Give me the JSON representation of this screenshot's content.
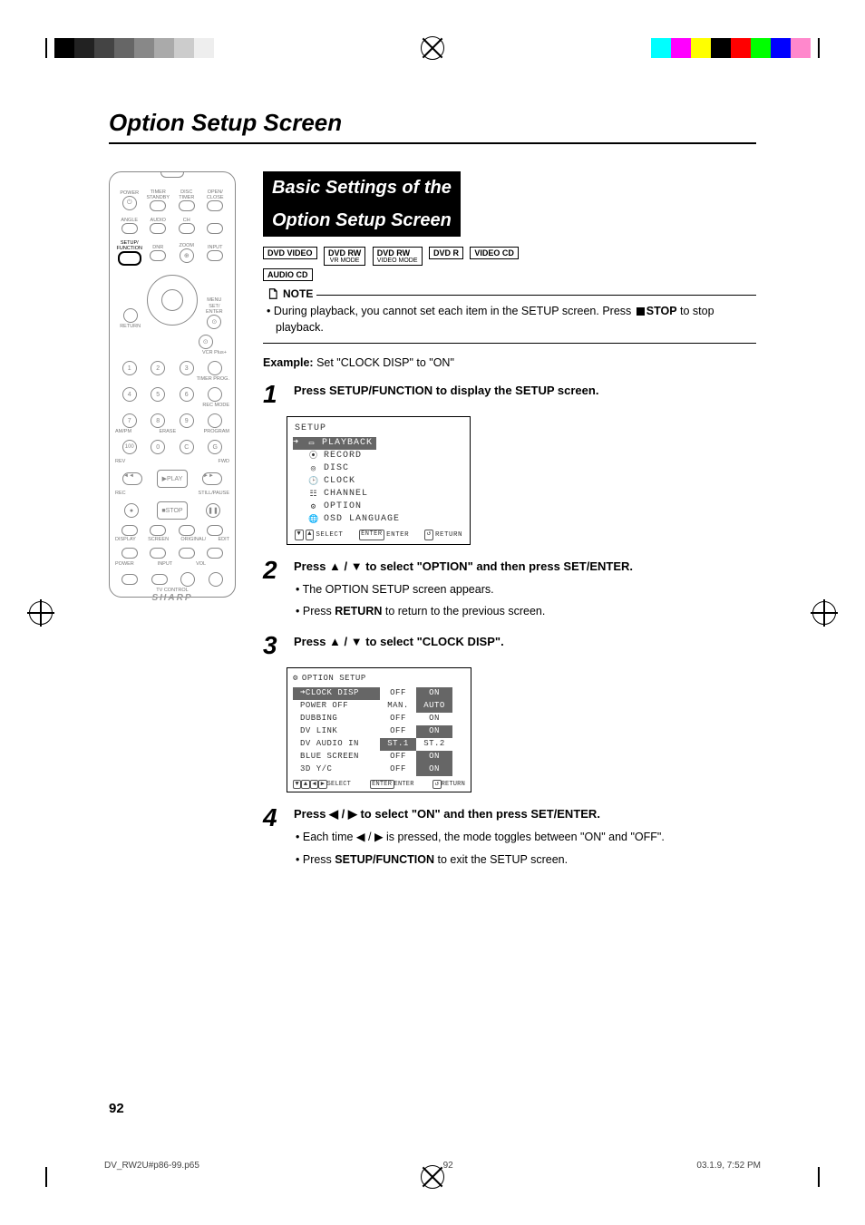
{
  "page_title": "Option Setup Screen",
  "page_number": "92",
  "remote": {
    "brand": "SHARP",
    "labels": {
      "power": "POWER",
      "timer_standby": "TIMER STANDBY",
      "disc_timer": "DISC TIMER",
      "open_close": "OPEN/ CLOSE",
      "angle": "ANGLE",
      "audio": "AUDIO",
      "ch": "CH",
      "setup_function": "SETUP/ FUNCTION",
      "dnr": "DNR",
      "zoom": "ZOOM",
      "input": "INPUT",
      "menu": "MENU",
      "return": "RETURN",
      "set_enter": "SET/ ENTER",
      "vcr_plus": "VCR Plus+",
      "timer_prog": "TIMER PROG.",
      "rec_mode": "REC MODE",
      "erase": "ERASE",
      "program": "PROGRAM",
      "am_pm": "AM/PM",
      "rev": "REV",
      "fwd": "FWD",
      "play": "PLAY",
      "rec": "REC",
      "stop": "STOP",
      "still_pause": "STILL/PAUSE",
      "display": "DISPLAY",
      "screen": "SCREEN",
      "original": "ORIGINAL/",
      "edit": "EDIT",
      "tv_power": "POWER",
      "tv_input": "INPUT",
      "vol": "VOL",
      "tv_control": "TV CONTROL",
      "c": "C",
      "g": "G"
    }
  },
  "section_heading_1": "Basic Settings of the",
  "section_heading_2": "Option Setup Screen",
  "badges": {
    "dvd_video": "DVD VIDEO",
    "dvd_rw_1": "DVD RW",
    "dvd_rw_1_sub": "VR MODE",
    "dvd_rw_2": "DVD RW",
    "dvd_rw_2_sub": "VIDEO MODE",
    "dvd_r": "DVD R",
    "video_cd": "VIDEO CD",
    "audio_cd": "AUDIO CD"
  },
  "note": {
    "label": "NOTE",
    "text_before": "During playback, you cannot set each item in the SETUP screen. Press ",
    "stop": "STOP",
    "text_after": " to stop playback."
  },
  "example": {
    "label": "Example:",
    "text": " Set \"CLOCK DISP\" to \"ON\""
  },
  "step1": {
    "num": "1",
    "head_before": "Press ",
    "head_bold": "SETUP/FUNCTION",
    "head_after": " to display the SETUP screen."
  },
  "osd_setup": {
    "title": "SETUP",
    "items": {
      "playback": "PLAYBACK",
      "record": "RECORD",
      "disc": "DISC",
      "clock": "CLOCK",
      "channel": "CHANNEL",
      "option": "OPTION",
      "osd_lang": "OSD LANGUAGE"
    },
    "bottom": {
      "select": "SELECT",
      "enter": "ENTER",
      "return": "RETURN"
    }
  },
  "step2": {
    "num": "2",
    "head": "Press ▲ / ▼ to select \"OPTION\" and then press ",
    "head_bold": "SET/ENTER",
    "head_after": ".",
    "sub1": "The OPTION SETUP screen appears.",
    "sub2_before": "Press ",
    "sub2_bold": "RETURN",
    "sub2_after": " to return to the previous screen."
  },
  "step3": {
    "num": "3",
    "head": "Press ▲ / ▼ to select \"CLOCK DISP\"."
  },
  "osd_option": {
    "title": "OPTION SETUP",
    "rows": [
      {
        "name": "CLOCK DISP",
        "v1": "OFF",
        "v2": "ON",
        "sel_name": true,
        "sel_v2": true
      },
      {
        "name": "POWER OFF",
        "v1": "MAN.",
        "v2": "AUTO",
        "sel_v2": true
      },
      {
        "name": "DUBBING",
        "v1": "OFF",
        "v2": "ON"
      },
      {
        "name": "DV LINK",
        "v1": "OFF",
        "v2": "ON",
        "sel_v2": true
      },
      {
        "name": "DV AUDIO IN",
        "v1": "ST.1",
        "v2": "ST.2",
        "sel_v1": true
      },
      {
        "name": "BLUE SCREEN",
        "v1": "OFF",
        "v2": "ON",
        "sel_v2": true
      },
      {
        "name": "3D Y/C",
        "v1": "OFF",
        "v2": "ON",
        "sel_v2": true
      }
    ],
    "bottom": {
      "select": "SELECT",
      "enter": "ENTER",
      "return": "RETURN"
    }
  },
  "step4": {
    "num": "4",
    "head_before": "Press ◀ / ▶ to select \"ON\" and then press ",
    "head_bold": "SET/ENTER",
    "head_after": ".",
    "sub1": "Each time ◀ / ▶ is pressed, the mode toggles between \"ON\" and \"OFF\".",
    "sub2_before": "Press ",
    "sub2_bold": "SETUP/FUNCTION",
    "sub2_after": " to exit the SETUP screen."
  },
  "footer": {
    "file": "DV_RW2U#p86-99.p65",
    "page": "92",
    "datetime": "03.1.9, 7:52 PM"
  }
}
